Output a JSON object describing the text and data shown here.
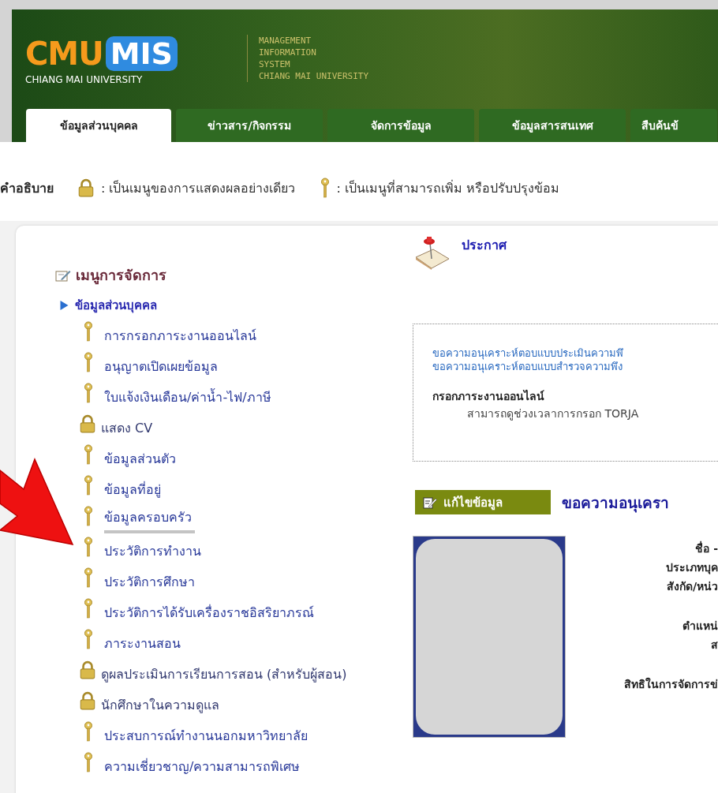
{
  "header": {
    "logo": {
      "part_1": "CMU",
      "part_2": "MIS",
      "subtitle": "CHIANG MAI UNIVERSITY"
    },
    "system_name": [
      "MANAGEMENT",
      "INFORMATION",
      "SYSTEM",
      "CHIANG MAI UNIVERSITY"
    ]
  },
  "tabs": [
    {
      "label": "ข้อมูลส่วนบุคคล",
      "selected": true
    },
    {
      "label": "ข่าวสาร/กิจกรรม",
      "selected": false
    },
    {
      "label": "จัดการข้อมูล",
      "selected": false
    },
    {
      "label": "ข้อมูลสารสนเทศ",
      "selected": false
    },
    {
      "label": "สืบค้นข้",
      "selected": false
    }
  ],
  "legend": {
    "label": "คำอธิบาย",
    "items": [
      {
        "kind": "lock",
        "text": ": เป็นเมนูของการแสดงผลอย่างเดียว"
      },
      {
        "kind": "key",
        "text": ": เป็นเมนูที่สามารถเพิ่ม หรือปรับปรุงข้อม"
      }
    ]
  },
  "menu": {
    "title": "เมนูการจัดการ",
    "section": {
      "label": "ข้อมูลส่วนบุคคล",
      "children": [
        {
          "label": "การกรอกภาระงานออนไลน์",
          "kind": "key",
          "selected": false
        },
        {
          "label": "อนุญาตเปิดเผยข้อมูล",
          "kind": "key",
          "selected": false
        },
        {
          "label": "ใบแจ้งเงินเดือน/ค่าน้ำ-ไฟ/ภาษี",
          "kind": "key",
          "selected": false
        },
        {
          "label": "แสดง CV",
          "kind": "lock",
          "selected": false
        },
        {
          "label": "ข้อมูลส่วนตัว",
          "kind": "key",
          "selected": false
        },
        {
          "label": "ข้อมูลที่อยู่",
          "kind": "key",
          "selected": false
        },
        {
          "label": "ข้อมูลครอบครัว",
          "kind": "key",
          "selected": true
        },
        {
          "label": "ประวัติการทำงาน",
          "kind": "key",
          "selected": false
        },
        {
          "label": "ประวัติการศึกษา",
          "kind": "key",
          "selected": false
        },
        {
          "label": "ประวัติการได้รับเครื่องราชอิสริยาภรณ์",
          "kind": "key",
          "selected": false
        },
        {
          "label": "ภาระงานสอน",
          "kind": "key",
          "selected": false
        },
        {
          "label": "ดูผลประเมินการเรียนการสอน (สำหรับผู้สอน)",
          "kind": "lock",
          "selected": false
        },
        {
          "label": "นักศึกษาในความดูแล",
          "kind": "lock",
          "selected": false
        },
        {
          "label": "ประสบการณ์ทำงานนอกมหาวิทยาลัย",
          "kind": "key",
          "selected": false
        },
        {
          "label": "ความเชี่ยวชาญ/ความสามารถพิเศษ",
          "kind": "key",
          "selected": false
        }
      ]
    }
  },
  "announcement": {
    "title": "ประกาศ",
    "links": [
      "ขอความอนุเคราะห์ตอบแบบประเมินความพึ",
      "ขอความอนุเคราะห์ตอบแบบสำรวจความพึง"
    ],
    "heading": "กรอกภาระงานออนไลน์",
    "detail": "สามารถดูช่วงเวลาการกรอก TORJA"
  },
  "profile": {
    "edit_button": "แก้ไขข้อมูล",
    "title": "ขอความอนุเครา",
    "field_groups": [
      [
        "ชื่อ -",
        "ประเภทบุค",
        "สังกัด/หน่ว"
      ],
      [
        "ตำแหน่",
        "ส"
      ],
      [
        "สิทธิในการจัดการข่"
      ]
    ]
  }
}
